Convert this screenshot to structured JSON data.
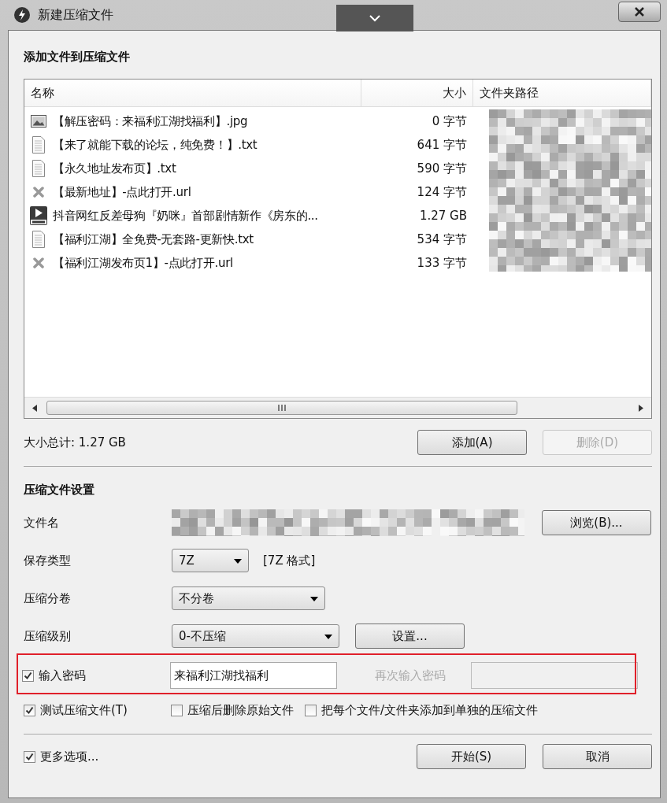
{
  "window": {
    "title": "新建压缩文件"
  },
  "add_section": {
    "title": "添加文件到压缩文件",
    "columns": [
      "名称",
      "大小",
      "文件夹路径"
    ],
    "files": [
      {
        "kind": "image",
        "name": "【解压密码：来福利江湖找福利】.jpg",
        "size": "0 字节"
      },
      {
        "kind": "text",
        "name": "【来了就能下载的论坛，纯免费！】.txt",
        "size": "641 字节"
      },
      {
        "kind": "text",
        "name": "【永久地址发布页】.txt",
        "size": "590 字节"
      },
      {
        "kind": "link",
        "name": "【最新地址】-点此打开.url",
        "size": "124 字节"
      },
      {
        "kind": "video",
        "name": "抖音网红反差母狗『奶咪』首部剧情新作《房东的...",
        "size": "1.27 GB"
      },
      {
        "kind": "text",
        "name": "【福利江湖】全免费-无套路-更新快.txt",
        "size": "534 字节"
      },
      {
        "kind": "link",
        "name": "【福利江湖发布页1】-点此打开.url",
        "size": "133 字节"
      }
    ],
    "total": "大小总计: 1.27 GB",
    "buttons": [
      {
        "label": "添加(A)",
        "disabled": false
      },
      {
        "label": "删除(D)",
        "disabled": true
      }
    ]
  },
  "settings": {
    "title": "压缩文件设置",
    "filename_label": "文件名",
    "browse_button": "浏览(B)...",
    "save_type": {
      "label": "保存类型",
      "value": "7Z",
      "note": "[7Z 格式]"
    },
    "split": {
      "label": "压缩分卷",
      "value": "不分卷"
    },
    "level": {
      "label": "压缩级别",
      "value": "0-不压缩",
      "button": "设置..."
    },
    "password": {
      "label": "输入密码",
      "checked": true,
      "value": "来福利江湖找福利",
      "confirm_label": "再次输入密码",
      "confirm_disabled": true
    },
    "options": [
      {
        "label": "测试压缩文件(T)",
        "checked": true
      },
      {
        "label": "压缩后删除原始文件",
        "checked": false
      },
      {
        "label": "把每个文件/文件夹添加到单独的压缩文件",
        "checked": false
      }
    ],
    "more": {
      "label": "更多选项...",
      "checked": true
    }
  },
  "buttons": [
    {
      "label": "开始(S)"
    },
    {
      "label": "取消"
    }
  ]
}
